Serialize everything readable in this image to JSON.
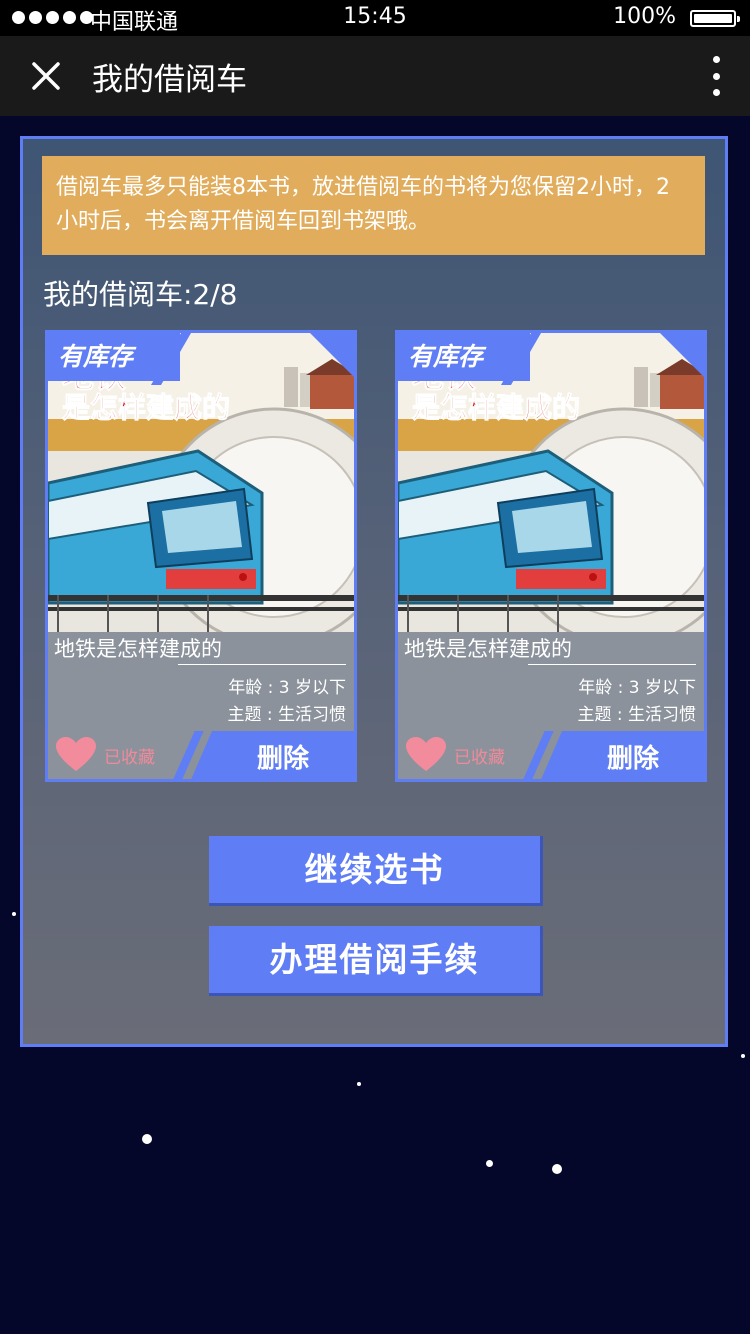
{
  "status_bar": {
    "carrier": "中国联通",
    "time": "15:45",
    "battery": "100%"
  },
  "nav": {
    "title": "我的借阅车",
    "close_icon": "close-icon",
    "more_icon": "more-vertical-icon"
  },
  "notice": {
    "text": "借阅车最多只能装8本书，放进借阅车的书将为您保留2小时，2小时后，书会离开借阅车回到书架哦。"
  },
  "cart": {
    "label": "我的借阅车:",
    "count": "2/8"
  },
  "books": [
    {
      "stock_tag": "有库存",
      "cover_title_top": "地铁",
      "cover_title": "是怎样建成的",
      "title": "地铁是怎样建成的",
      "age": "年龄 : 3 岁以下",
      "theme": "主题 : 生活习惯",
      "favorite_label": "已收藏",
      "delete_label": "删除"
    },
    {
      "stock_tag": "有库存",
      "cover_title_top": "地铁",
      "cover_title": "是怎样建成的",
      "title": "地铁是怎样建成的",
      "age": "年龄 : 3 岁以下",
      "theme": "主题 : 生活习惯",
      "favorite_label": "已收藏",
      "delete_label": "删除"
    }
  ],
  "buttons": {
    "continue_label": "继续选书",
    "checkout_label": "办理借阅手续"
  },
  "colors": {
    "accent": "#5f7df5",
    "notice_bg": "#e1ad5c",
    "favorite": "#f08a9a",
    "background": "#05072a"
  }
}
